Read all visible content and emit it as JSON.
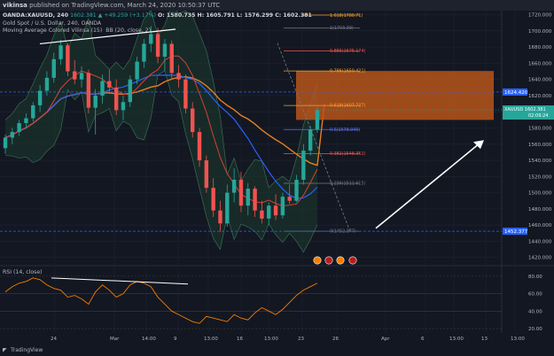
{
  "header": {
    "user": "vikinsa",
    "published": "published on TradingView.com, March 24, 2020 10:50:37 UTC"
  },
  "legend": {
    "symbol_line": "OANDA:XAUUSD, 240",
    "price_line": "1602.381 ▲ +49.259 (+3.17%)",
    "ohlc": "O: 1580.735  H: 1605.791  L: 1576.299  C: 1602.381",
    "title": "Gold Spot / U.S. Dollar, 240, OANDA",
    "ma": "Moving Average Colored Vilinsa (15)",
    "bb": "BB (20, close, 2)",
    "rsi": "RSI (14, close)"
  },
  "footer": {
    "brand": "TradingView"
  },
  "colors": {
    "bg": "#131722",
    "up": "#26a69a",
    "down": "#ef5350",
    "grid": "#1f2430",
    "bb_fill": "#1b3a2d",
    "fib_box": "#b7551b",
    "ma_orange": "#e67e22",
    "ma_blue": "#2962ff",
    "ma_red": "#d6403a",
    "rsi_line": "#f57c00"
  },
  "chart_data": [
    {
      "type": "candlestick",
      "title": "Gold Spot / U.S. Dollar, 240, OANDA",
      "ylim": [
        1412,
        1725
      ],
      "y_ticks": [
        1420,
        1440,
        1460,
        1480,
        1500,
        1520,
        1540,
        1560,
        1580,
        1600,
        1620,
        1640,
        1660,
        1680,
        1700,
        1720
      ],
      "x_ticks": [
        "24",
        "Mar",
        "14:00",
        "9",
        "13:00",
        "16",
        "13:00",
        "23",
        "26",
        "Apr",
        "6",
        "13:00",
        "13",
        "13:00"
      ],
      "series": [
        {
          "name": "XAUUSD",
          "last": 1602.381,
          "label": "XAUUSD",
          "price_label": "1602.381",
          "countdown": "02:09:24"
        }
      ],
      "horizontal_lines": [
        {
          "value": 1624.42,
          "label": "1624.420"
        },
        {
          "value": 1452.377,
          "label": "1452.377"
        }
      ],
      "fib_levels": [
        {
          "ratio": "1.618",
          "value": 1780.71,
          "label": "1.618(1780.71)"
        },
        {
          "ratio": "1",
          "value": 1703.39,
          "label": "1(1703.39)"
        },
        {
          "ratio": "0.886",
          "value": 1675.174,
          "label": "0.886(1675.174)"
        },
        {
          "ratio": "0.786",
          "value": 1650.421,
          "label": "0.786(1650.421)"
        },
        {
          "ratio": "0.618",
          "value": 1607.737,
          "label": "0.618(1607.737)"
        },
        {
          "ratio": "0.5",
          "value": 1578.045,
          "label": "0.5(1578.045)"
        },
        {
          "ratio": "0.382",
          "value": 1548.352,
          "label": "0.382(1548.352)"
        },
        {
          "ratio": "0.236",
          "value": 1511.615,
          "label": "0.236(1511.615)"
        },
        {
          "ratio": "0",
          "value": 1452.377,
          "label": "0(1452.377)"
        }
      ],
      "target_zone": {
        "top": 1650.4,
        "bottom": 1590.0
      },
      "candles": [
        [
          1555,
          1572,
          1548,
          1568
        ],
        [
          1568,
          1580,
          1560,
          1575
        ],
        [
          1575,
          1590,
          1570,
          1586
        ],
        [
          1586,
          1598,
          1579,
          1592
        ],
        [
          1592,
          1612,
          1588,
          1608
        ],
        [
          1608,
          1633,
          1600,
          1626
        ],
        [
          1626,
          1650,
          1620,
          1642
        ],
        [
          1642,
          1673,
          1636,
          1665
        ],
        [
          1665,
          1689,
          1658,
          1682
        ],
        [
          1682,
          1685,
          1644,
          1650
        ],
        [
          1650,
          1664,
          1634,
          1640
        ],
        [
          1640,
          1656,
          1630,
          1648
        ],
        [
          1648,
          1652,
          1598,
          1605
        ],
        [
          1605,
          1628,
          1572,
          1620
        ],
        [
          1620,
          1646,
          1610,
          1638
        ],
        [
          1638,
          1652,
          1622,
          1630
        ],
        [
          1630,
          1640,
          1596,
          1602
        ],
        [
          1602,
          1620,
          1590,
          1612
        ],
        [
          1612,
          1645,
          1606,
          1640
        ],
        [
          1640,
          1668,
          1634,
          1662
        ],
        [
          1662,
          1690,
          1654,
          1684
        ],
        [
          1684,
          1706,
          1674,
          1696
        ],
        [
          1696,
          1704,
          1660,
          1668
        ],
        [
          1668,
          1690,
          1650,
          1684
        ],
        [
          1684,
          1688,
          1640,
          1648
        ],
        [
          1648,
          1658,
          1630,
          1640
        ],
        [
          1640,
          1646,
          1598,
          1604
        ],
        [
          1604,
          1612,
          1568,
          1575
        ],
        [
          1575,
          1580,
          1532,
          1540
        ],
        [
          1540,
          1546,
          1500,
          1506
        ],
        [
          1506,
          1518,
          1470,
          1478
        ],
        [
          1478,
          1490,
          1452,
          1462
        ],
        [
          1462,
          1510,
          1458,
          1500
        ],
        [
          1500,
          1530,
          1488,
          1516
        ],
        [
          1516,
          1526,
          1476,
          1484
        ],
        [
          1484,
          1512,
          1472,
          1505
        ],
        [
          1505,
          1508,
          1470,
          1478
        ],
        [
          1478,
          1490,
          1462,
          1468
        ],
        [
          1468,
          1488,
          1460,
          1484
        ],
        [
          1484,
          1498,
          1466,
          1472
        ],
        [
          1472,
          1500,
          1468,
          1495
        ],
        [
          1495,
          1510,
          1486,
          1490
        ],
        [
          1490,
          1522,
          1488,
          1516
        ],
        [
          1516,
          1560,
          1510,
          1552
        ],
        [
          1552,
          1582,
          1546,
          1578
        ],
        [
          1578,
          1606,
          1574,
          1602
        ]
      ]
    },
    {
      "type": "line",
      "title": "RSI (14, close)",
      "ylim": [
        15,
        90
      ],
      "y_ticks": [
        20,
        40,
        60,
        80
      ],
      "y_tick_labels": [
        "20.00",
        "40.00",
        "60.00",
        "80.00"
      ],
      "series": [
        {
          "name": "RSI (14, close)",
          "values": [
            62,
            68,
            72,
            74,
            78,
            76,
            70,
            66,
            64,
            56,
            58,
            54,
            48,
            62,
            70,
            64,
            56,
            60,
            70,
            74,
            72,
            68,
            56,
            48,
            40,
            36,
            32,
            28,
            26,
            34,
            32,
            30,
            28,
            36,
            32,
            30,
            38,
            44,
            40,
            36,
            42,
            50,
            58,
            64,
            68,
            72
          ]
        }
      ]
    }
  ]
}
